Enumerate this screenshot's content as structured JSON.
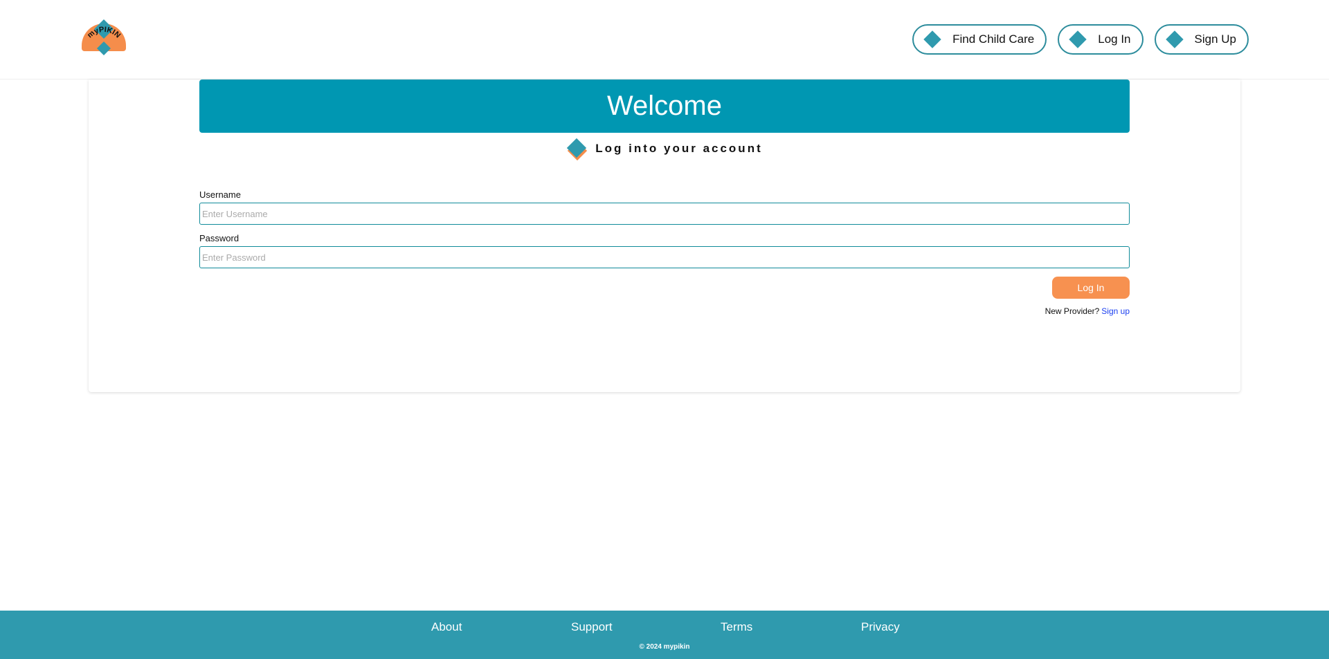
{
  "brand": {
    "logo_text": "myPIKIN",
    "accent": "#2f9aae",
    "secondary": "#f58d4b"
  },
  "nav": {
    "items": [
      {
        "label": "Find Child Care",
        "icon": "diamond-icon"
      },
      {
        "label": "Log In",
        "icon": "diamond-icon"
      },
      {
        "label": "Sign Up",
        "icon": "diamond-icon"
      }
    ]
  },
  "banner": {
    "title": "Welcome",
    "color": "#0097b2"
  },
  "form": {
    "subtitle": "Log into your account",
    "username_label": "Username",
    "username_placeholder": "Enter Username",
    "password_label": "Password",
    "password_placeholder": "Enter Password",
    "submit_label": "Log In",
    "submit_color": "#f79150",
    "signup_prompt": "New Provider?",
    "signup_link": "Sign up"
  },
  "footer": {
    "links": [
      "About",
      "Support",
      "Terms",
      "Privacy"
    ],
    "copyright": "© 2024 mypikin"
  }
}
